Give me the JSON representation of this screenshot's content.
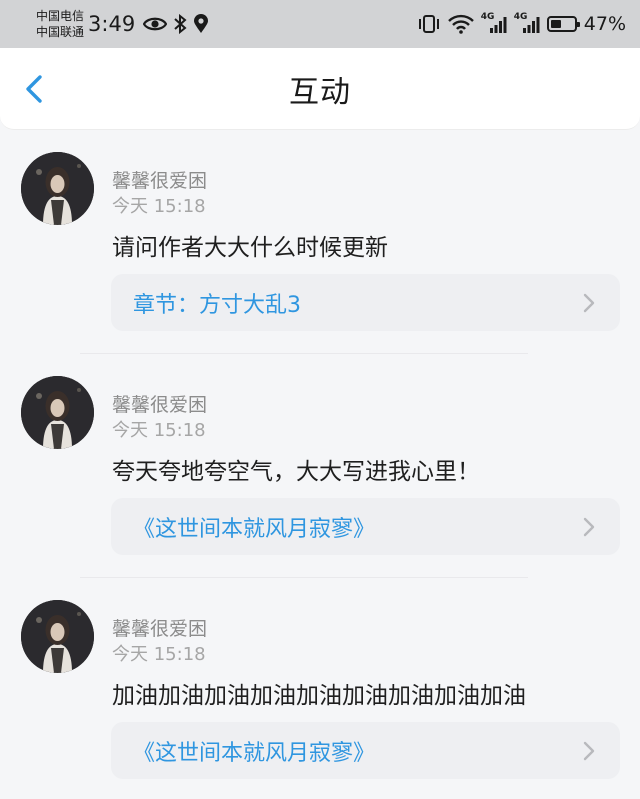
{
  "status_bar": {
    "carrier_1": "中国电信",
    "carrier_2": "中国联通",
    "time": "3:49",
    "signal_label_1": "4G",
    "signal_label_2": "4G",
    "battery_percent": "47%",
    "battery_level": 0.47,
    "icons": [
      "eye-icon",
      "bluetooth-icon",
      "location-icon",
      "vibrate-icon",
      "wifi-icon",
      "signal-icon",
      "battery-icon"
    ]
  },
  "header": {
    "title": "互动",
    "back_icon": "back-chevron-icon"
  },
  "colors": {
    "accent": "#2f96e0",
    "status_bar_bg": "#d2d3d5",
    "card_bg": "#eeeff2",
    "page_bg": "#f5f6f8"
  },
  "posts": [
    {
      "username": "馨馨很爱困",
      "time": "今天 15:18",
      "content": "请问作者大大什么时候更新",
      "ref": "章节：方寸大乱3"
    },
    {
      "username": "馨馨很爱困",
      "time": "今天 15:18",
      "content": "夸天夸地夸空气，大大写进我心里！",
      "ref": "《这世间本就风月寂寥》"
    },
    {
      "username": "馨馨很爱困",
      "time": "今天 15:18",
      "content": "加油加油加油加油加油加油加油加油加油",
      "ref": "《这世间本就风月寂寥》"
    }
  ]
}
